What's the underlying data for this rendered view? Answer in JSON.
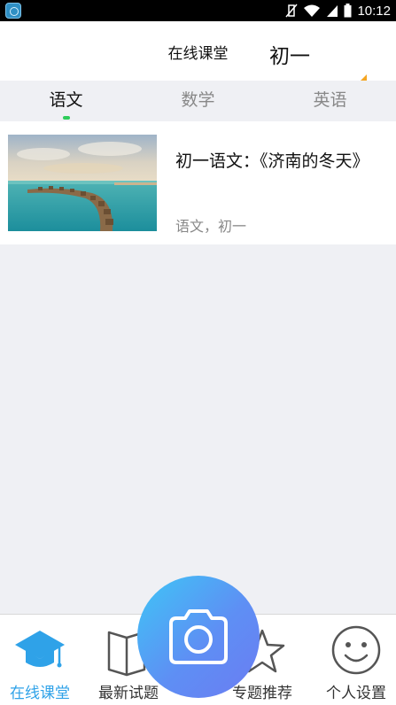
{
  "status_bar": {
    "time": "10:12"
  },
  "header": {
    "title": "在线课堂",
    "grade": "初一"
  },
  "tabs": [
    {
      "label": "语文",
      "active": true
    },
    {
      "label": "数学",
      "active": false
    },
    {
      "label": "英语",
      "active": false
    }
  ],
  "courses": [
    {
      "title": "初一语文：《济南的冬天》",
      "meta": "语文，初一",
      "thumbnail": "resort-over-water-photo"
    }
  ],
  "bottom_nav": [
    {
      "label": "在线课堂",
      "icon": "graduation-cap-icon",
      "active": true
    },
    {
      "label": "最新试题",
      "icon": "book-icon",
      "active": false
    },
    {
      "label": "专题推荐",
      "icon": "star-icon",
      "active": false
    },
    {
      "label": "个人设置",
      "icon": "smiley-icon",
      "active": false
    }
  ],
  "fab": {
    "icon": "camera-icon"
  },
  "colors": {
    "accent_blue": "#2fa2e8",
    "tab_indicator": "#2ecc5a",
    "grade_arrow": "#f5a623"
  }
}
